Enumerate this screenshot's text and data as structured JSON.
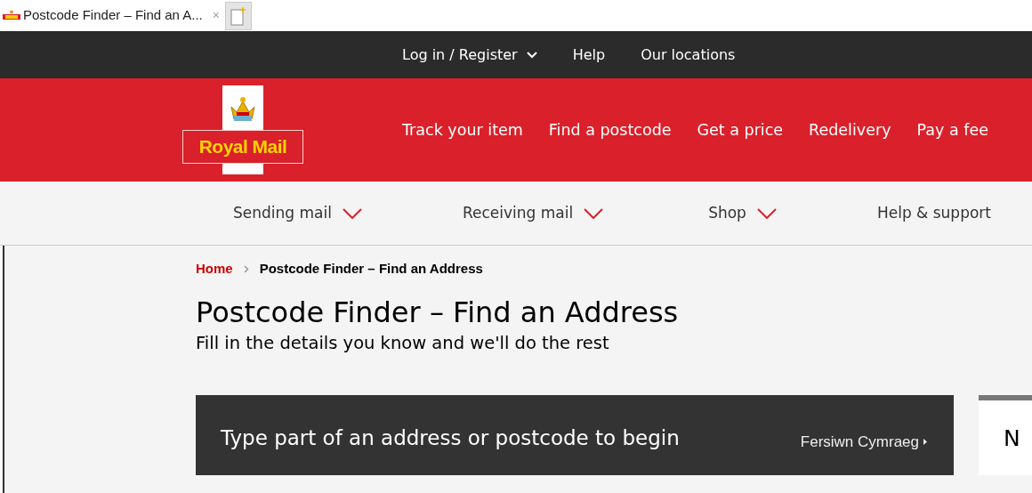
{
  "browser_tab": {
    "title": "Postcode Finder – Find an A...",
    "close": "×",
    "selected": true
  },
  "top_bar": {
    "items": [
      {
        "label": "Log in / Register",
        "has_menu": true
      },
      {
        "label": "Help",
        "has_menu": false
      },
      {
        "label": "Our locations",
        "has_menu": false
      }
    ]
  },
  "header": {
    "logo_text": "Royal Mail",
    "nav": [
      "Track your item",
      "Find a postcode",
      "Get a price",
      "Redelivery",
      "Pay a fee"
    ]
  },
  "main_nav": [
    "Sending mail",
    "Receiving mail",
    "Shop",
    "Help & support"
  ],
  "main_nav_menus": [
    true,
    true,
    true,
    false
  ],
  "breadcrumb": [
    {
      "label": "Home",
      "current": false
    },
    {
      "label": "Postcode Finder – Find an Address",
      "current": true
    }
  ],
  "page": {
    "title": "Postcode Finder – Find an Address",
    "subtitle": "Fill in the details you know and we'll do the rest"
  },
  "search_panel": {
    "heading": "Type part of an address or postcode to begin",
    "language_link": "Fersiwn Cymraeg"
  },
  "side_card": {
    "heading": "N"
  }
}
